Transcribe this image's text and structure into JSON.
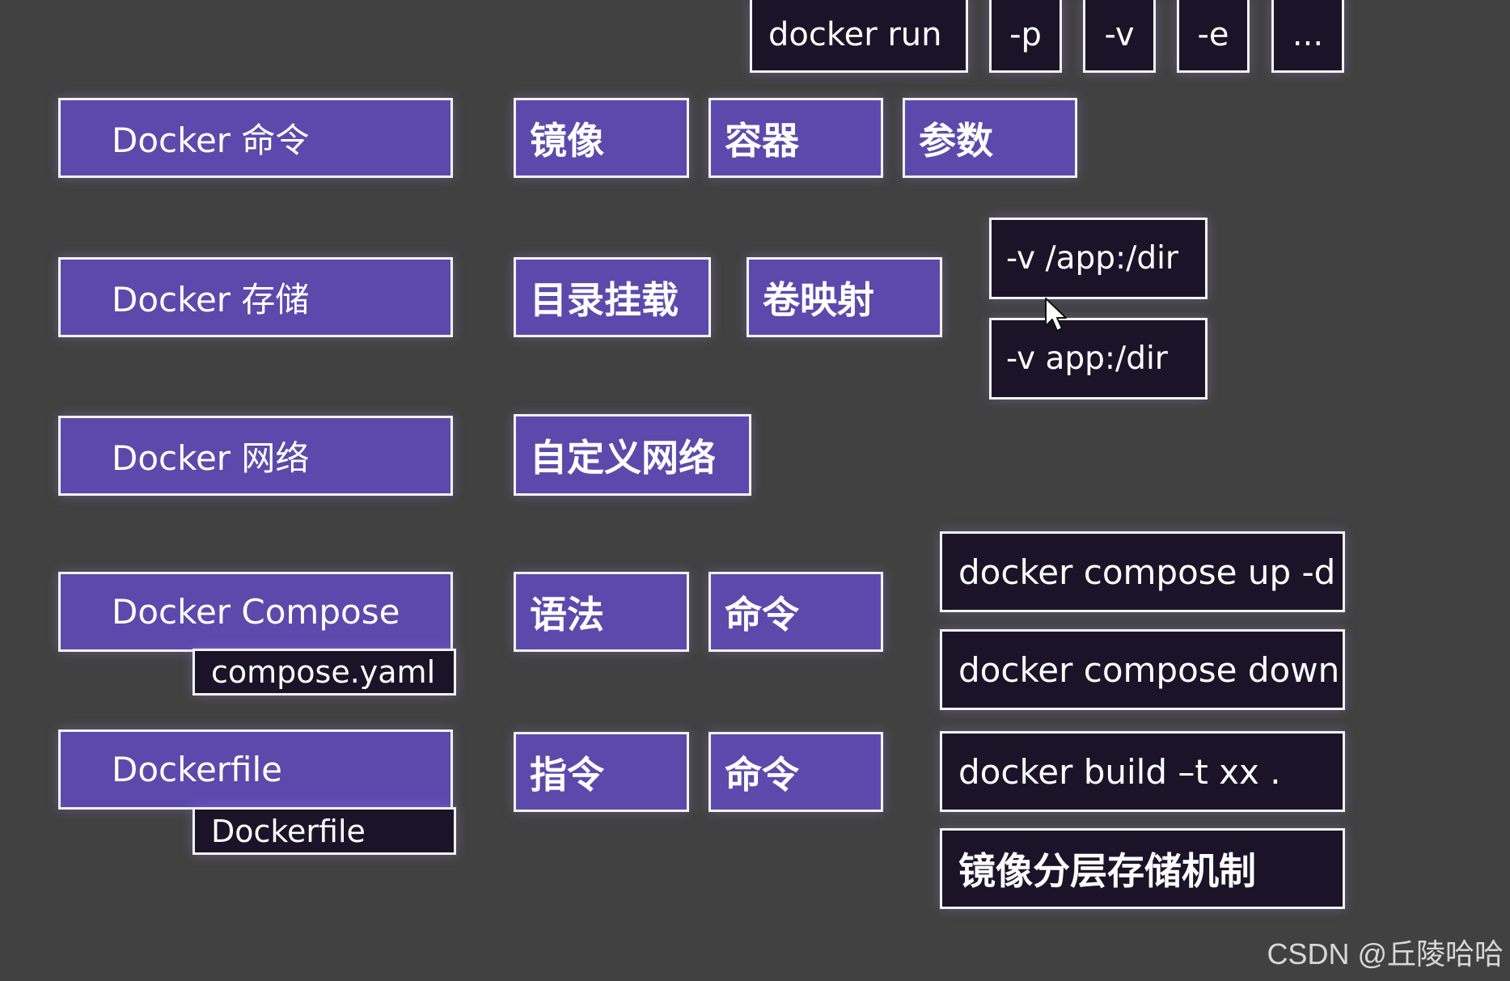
{
  "run_row": {
    "cmd": "docker run",
    "p": "-p",
    "v": "-v",
    "e": "-e",
    "more": "..."
  },
  "rows": {
    "commands": {
      "label": "Docker 命令",
      "items": [
        "镜像",
        "容器",
        "参数"
      ]
    },
    "storage": {
      "label": "Docker 存储",
      "items": [
        "目录挂载",
        "卷映射"
      ],
      "examples": [
        "-v /app:/dir",
        "-v app:/dir"
      ]
    },
    "network": {
      "label": "Docker 网络",
      "items": [
        "自定义网络"
      ]
    },
    "compose": {
      "label": "Docker Compose",
      "tag": "compose.yaml",
      "items": [
        "语法",
        "命令"
      ],
      "commands": [
        "docker compose up -d",
        "docker compose down"
      ]
    },
    "dockerfile": {
      "label": "Dockerfile",
      "tag": "Dockerfile",
      "items": [
        "指令",
        "命令"
      ],
      "commands": [
        "docker build –t xx .",
        "镜像分层存储机制"
      ]
    }
  },
  "watermark": "CSDN @丘陵哈哈",
  "colors": {
    "background": "#414141",
    "purple_box": "#5b4aac",
    "dark_box": "#1b1429",
    "border": "#f2f2f2"
  },
  "icons": [
    "mouse-cursor-icon"
  ]
}
